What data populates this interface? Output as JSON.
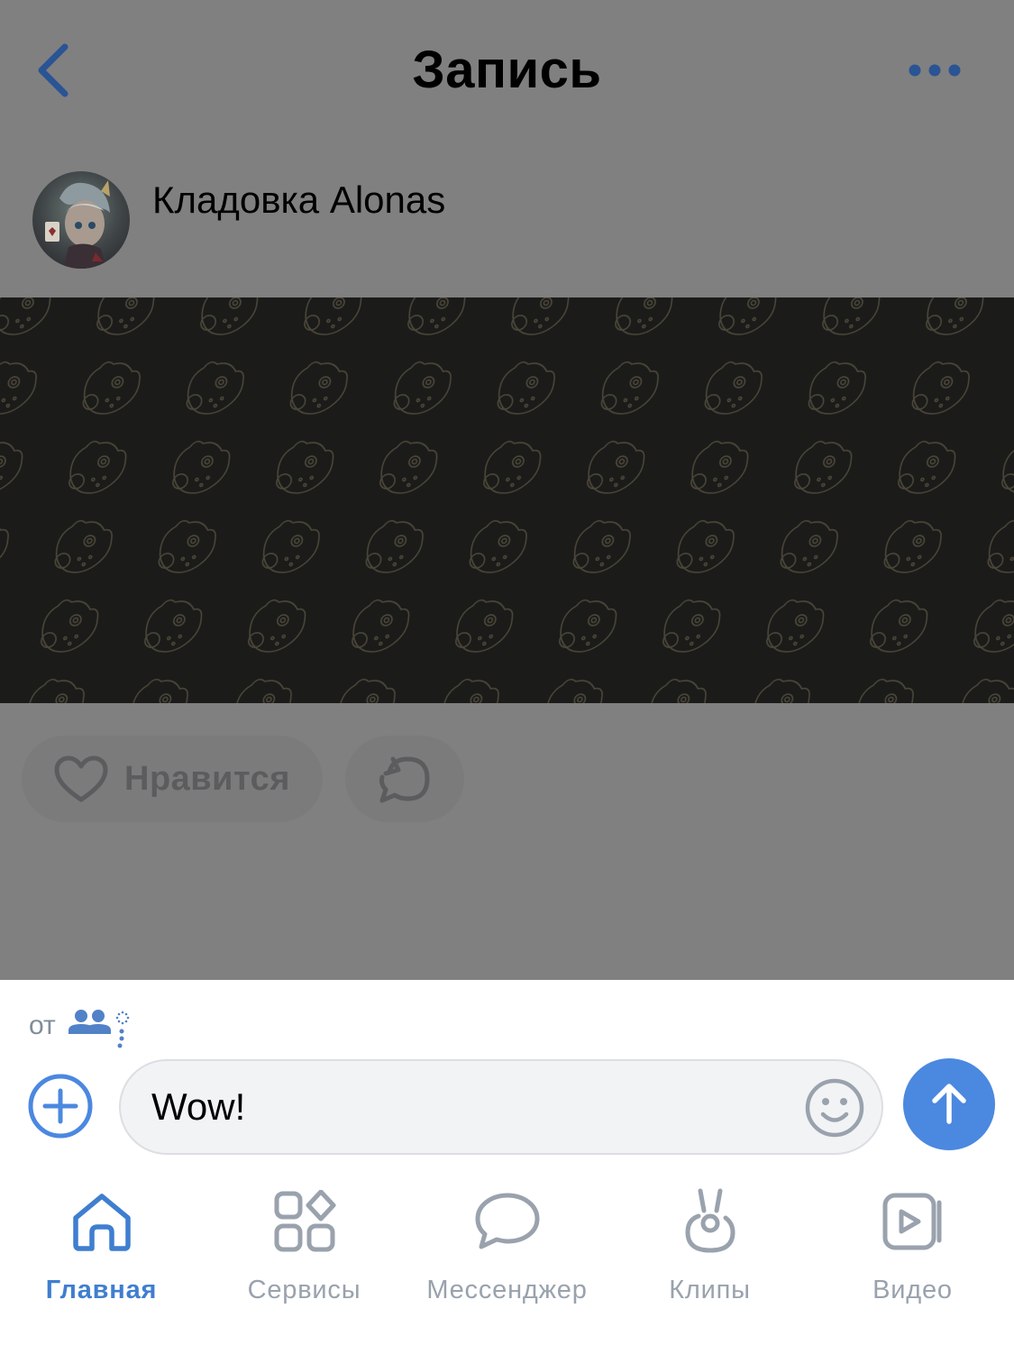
{
  "nav": {
    "title": "Запись",
    "back_icon": "chevron-left-icon",
    "more_icon": "more-horizontal-icon"
  },
  "post": {
    "author": "Кладовка Alonas",
    "like_label": "Нравится"
  },
  "composer": {
    "from_label": "от",
    "message_value": "Wow!",
    "message_placeholder": ""
  },
  "tabs": [
    {
      "label": "Главная",
      "icon": "home-icon",
      "active": true
    },
    {
      "label": "Сервисы",
      "icon": "services-icon",
      "active": false
    },
    {
      "label": "Мессенджер",
      "icon": "messenger-icon",
      "active": false
    },
    {
      "label": "Клипы",
      "icon": "clips-icon",
      "active": false
    },
    {
      "label": "Видео",
      "icon": "video-icon",
      "active": false
    }
  ],
  "colors": {
    "accent": "#4b88e0",
    "dim_overlay": "#808080",
    "tab_inactive": "#99a2ad",
    "tab_active": "#3f7ed0",
    "post_image_bg": "#1b1b1a"
  }
}
